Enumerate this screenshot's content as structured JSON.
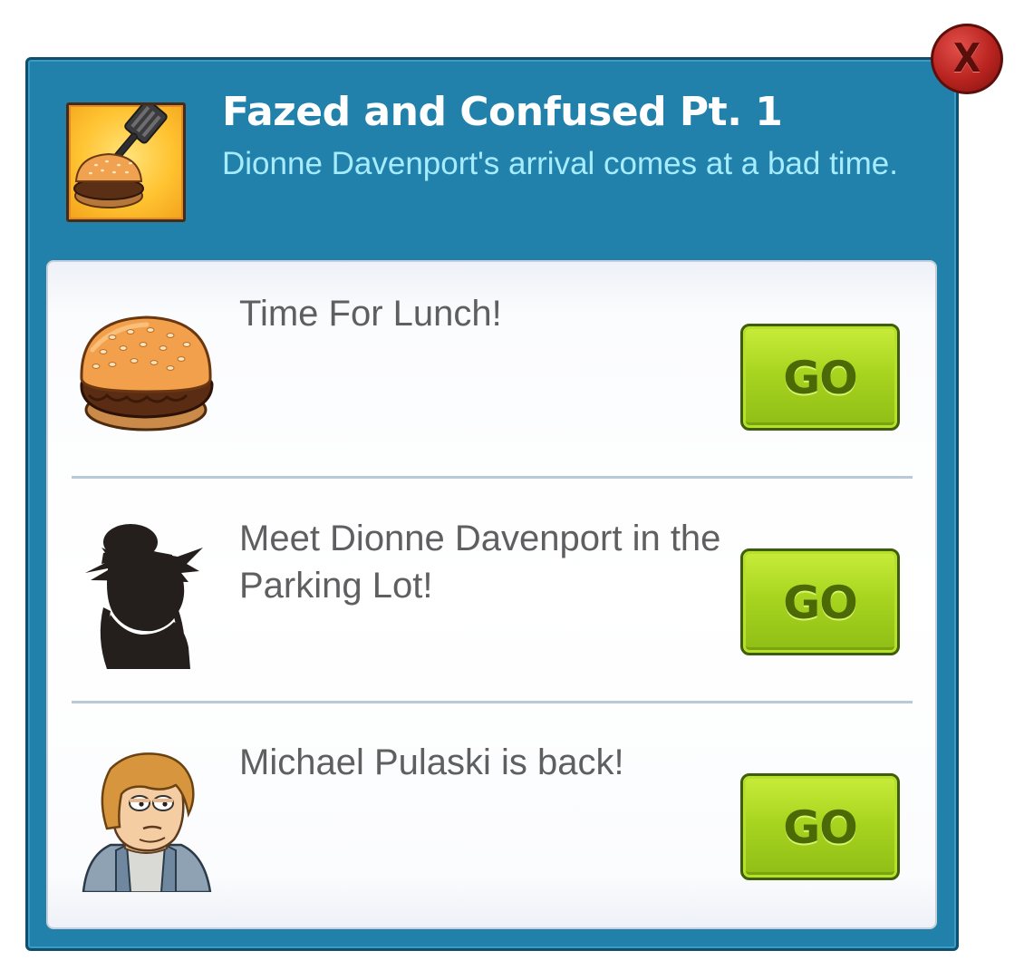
{
  "quest": {
    "title": "Fazed and Confused Pt. 1",
    "subtitle": "Dionne Davenport's arrival comes at a bad time.",
    "icon": "burger-spatula-icon"
  },
  "close_button": {
    "label": "X"
  },
  "tasks": [
    {
      "text": "Time For Lunch!",
      "image": "burger-icon",
      "button_label": "GO"
    },
    {
      "text": "Meet Dionne Davenport in the Parking Lot!",
      "image": "character-silhouette",
      "button_label": "GO"
    },
    {
      "text": "Michael Pulaski is back!",
      "image": "michael-pulaski-portrait",
      "button_label": "GO"
    }
  ],
  "colors": {
    "dialog_bg": "#2281ab",
    "subtitle": "#a6ecff",
    "go_button": "#a8d51f",
    "close_button": "#b8231f"
  }
}
